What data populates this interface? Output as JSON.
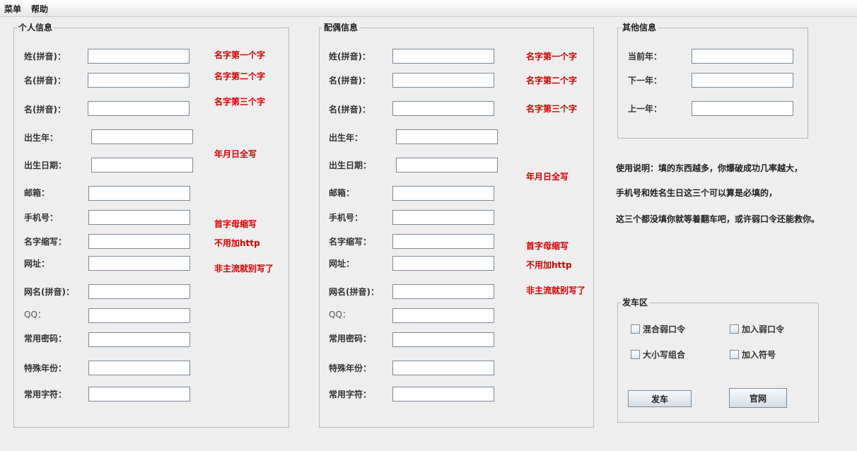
{
  "menu": {
    "items": [
      "菜单",
      "帮助"
    ]
  },
  "personal": {
    "title": "个人信息",
    "fields": [
      "姓(拼音)：",
      "名(拼音)：",
      "名(拼音)：",
      "出生年：",
      "出生日期：",
      "邮箱：",
      "手机号：",
      "名字缩写：",
      "网址：",
      "网名(拼音)：",
      "QQ：",
      "常用密码：",
      "特殊年份：",
      "常用字符："
    ],
    "hints": [
      "名字第一个字",
      "名字第二个字",
      "名字第三个字",
      "年月日全写",
      "首字母缩写",
      "不用加http",
      "非主流就别写了"
    ]
  },
  "spouse": {
    "title": "配偶信息",
    "fields": [
      "姓(拼音)：",
      "名(拼音)：",
      "名(拼音)：",
      "出生年：",
      "出生日期：",
      "邮箱：",
      "手机号：",
      "名字缩写：",
      "网址：",
      "网名(拼音)：",
      "QQ：",
      "常用密码：",
      "特殊年份：",
      "常用字符："
    ],
    "hints": [
      "名字第一个字",
      "名字第二个字",
      "名字第三个字",
      "年月日全写",
      "首字母缩写",
      "不用加http",
      "非主流就别写了"
    ]
  },
  "other": {
    "title": "其他信息",
    "fields": [
      "当前年：",
      "下一年：",
      "上一年："
    ]
  },
  "instructions": [
    "使用说明：填的东西越多，你爆破成功几率越大，",
    "手机号和姓名生日这三个可以算是必填的，",
    "这三个都没填你就等着翻车吧，或许弱口令还能救你。"
  ],
  "launch": {
    "title": "发车区",
    "options": [
      "混合弱口令",
      "加入弱口令",
      "大小写组合",
      "加入符号"
    ],
    "launch_button": "发车",
    "website_button": "官网"
  },
  "colors": {
    "hint": "#d40000",
    "background": "#eeeeee"
  }
}
